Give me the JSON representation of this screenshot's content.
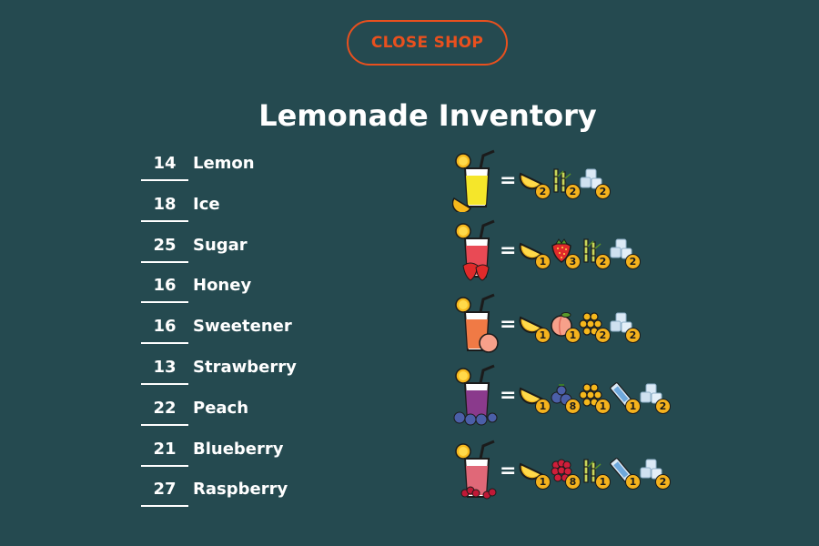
{
  "shop": {
    "close_label": "CLOSE SHOP"
  },
  "inventory": {
    "title": "Lemonade Inventory",
    "items": [
      {
        "qty": "14",
        "name": "Lemon"
      },
      {
        "qty": "18",
        "name": "Ice"
      },
      {
        "qty": "25",
        "name": "Sugar"
      },
      {
        "qty": "16",
        "name": "Honey"
      },
      {
        "qty": "16",
        "name": "Sweetener"
      },
      {
        "qty": "13",
        "name": "Strawberry"
      },
      {
        "qty": "22",
        "name": "Peach"
      },
      {
        "qty": "21",
        "name": "Blueberry"
      },
      {
        "qty": "27",
        "name": "Raspberry"
      }
    ]
  },
  "recipes": [
    {
      "drink_icon": "lemonade-glass-icon",
      "drink_color": "#f5e62a",
      "fruit": "lemon",
      "ingredients": [
        {
          "icon": "lemon-icon",
          "count": "2"
        },
        {
          "icon": "sugar-cane-icon",
          "count": "2"
        },
        {
          "icon": "ice-icon",
          "count": "2"
        }
      ]
    },
    {
      "drink_icon": "strawberry-lemonade-glass-icon",
      "drink_color": "#e94a55",
      "fruit": "strawberry",
      "ingredients": [
        {
          "icon": "lemon-icon",
          "count": "1"
        },
        {
          "icon": "strawberry-icon",
          "count": "3"
        },
        {
          "icon": "sugar-cane-icon",
          "count": "2"
        },
        {
          "icon": "ice-icon",
          "count": "2"
        }
      ]
    },
    {
      "drink_icon": "peach-lemonade-glass-icon",
      "drink_color": "#f07a45",
      "fruit": "peach",
      "ingredients": [
        {
          "icon": "lemon-icon",
          "count": "1"
        },
        {
          "icon": "peach-icon",
          "count": "1"
        },
        {
          "icon": "honey-icon",
          "count": "2"
        },
        {
          "icon": "ice-icon",
          "count": "2"
        }
      ]
    },
    {
      "drink_icon": "blueberry-lemonade-glass-icon",
      "drink_color": "#8a3a8c",
      "fruit": "blueberry",
      "ingredients": [
        {
          "icon": "lemon-icon",
          "count": "1"
        },
        {
          "icon": "blueberry-icon",
          "count": "8"
        },
        {
          "icon": "honey-icon",
          "count": "1"
        },
        {
          "icon": "sweetener-packet-icon",
          "count": "1"
        },
        {
          "icon": "ice-icon",
          "count": "2"
        }
      ]
    },
    {
      "drink_icon": "raspberry-lemonade-glass-icon",
      "drink_color": "#e06878",
      "fruit": "raspberry",
      "ingredients": [
        {
          "icon": "lemon-icon",
          "count": "1"
        },
        {
          "icon": "raspberry-icon",
          "count": "8"
        },
        {
          "icon": "sugar-cane-icon",
          "count": "1"
        },
        {
          "icon": "sweetener-packet-icon",
          "count": "1"
        },
        {
          "icon": "ice-icon",
          "count": "2"
        }
      ]
    }
  ],
  "colors": {
    "background": "#254a50",
    "accent": "#e9501e",
    "badge": "#f4b21d"
  }
}
